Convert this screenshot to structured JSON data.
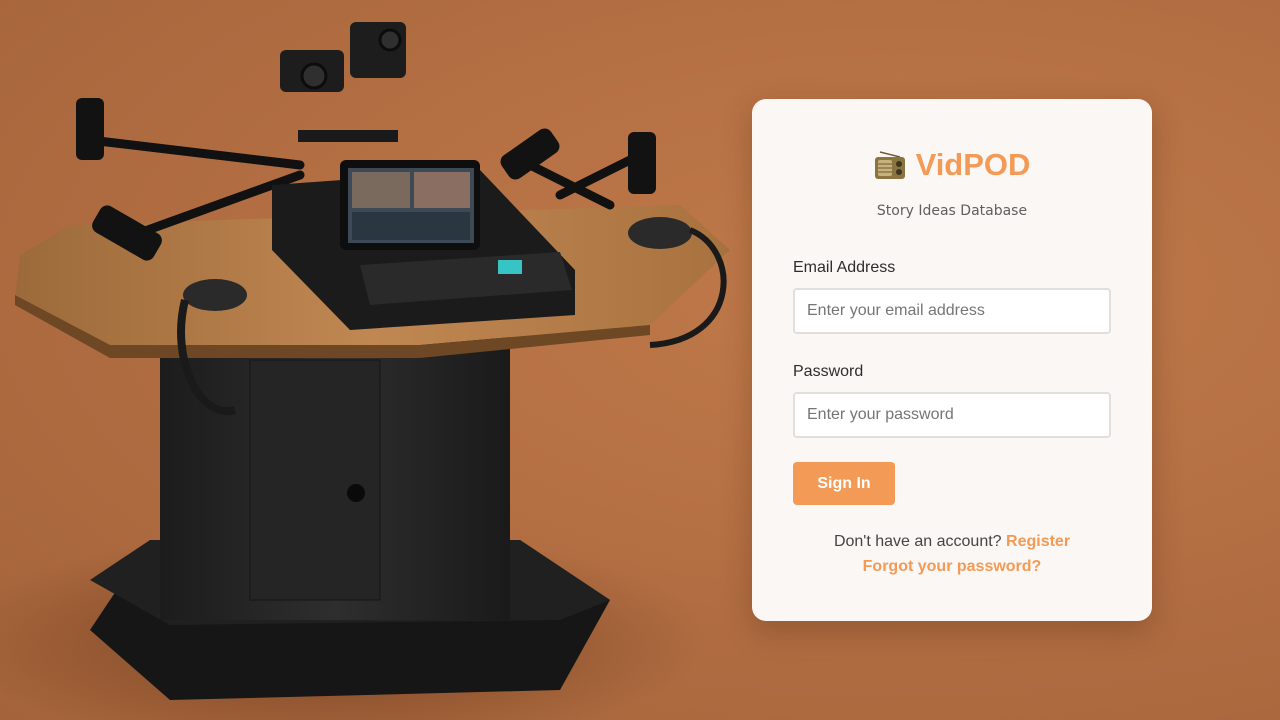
{
  "app": {
    "name": "VidPOD",
    "subtitle": "Story Ideas Database",
    "brand_icon": "radio-icon",
    "accent_color": "#f29a56",
    "background_color": "#b46f43"
  },
  "login": {
    "email_label": "Email Address",
    "email_placeholder": "Enter your email address",
    "email_value": "",
    "password_label": "Password",
    "password_placeholder": "Enter your password",
    "password_value": "",
    "submit_label": "Sign In"
  },
  "footer": {
    "no_account_text": "Don't have an account?",
    "register_label": "Register",
    "forgot_label": "Forgot your password?"
  },
  "hero": {
    "subject": "podcast-studio-desk-image",
    "description_hidden": true
  }
}
